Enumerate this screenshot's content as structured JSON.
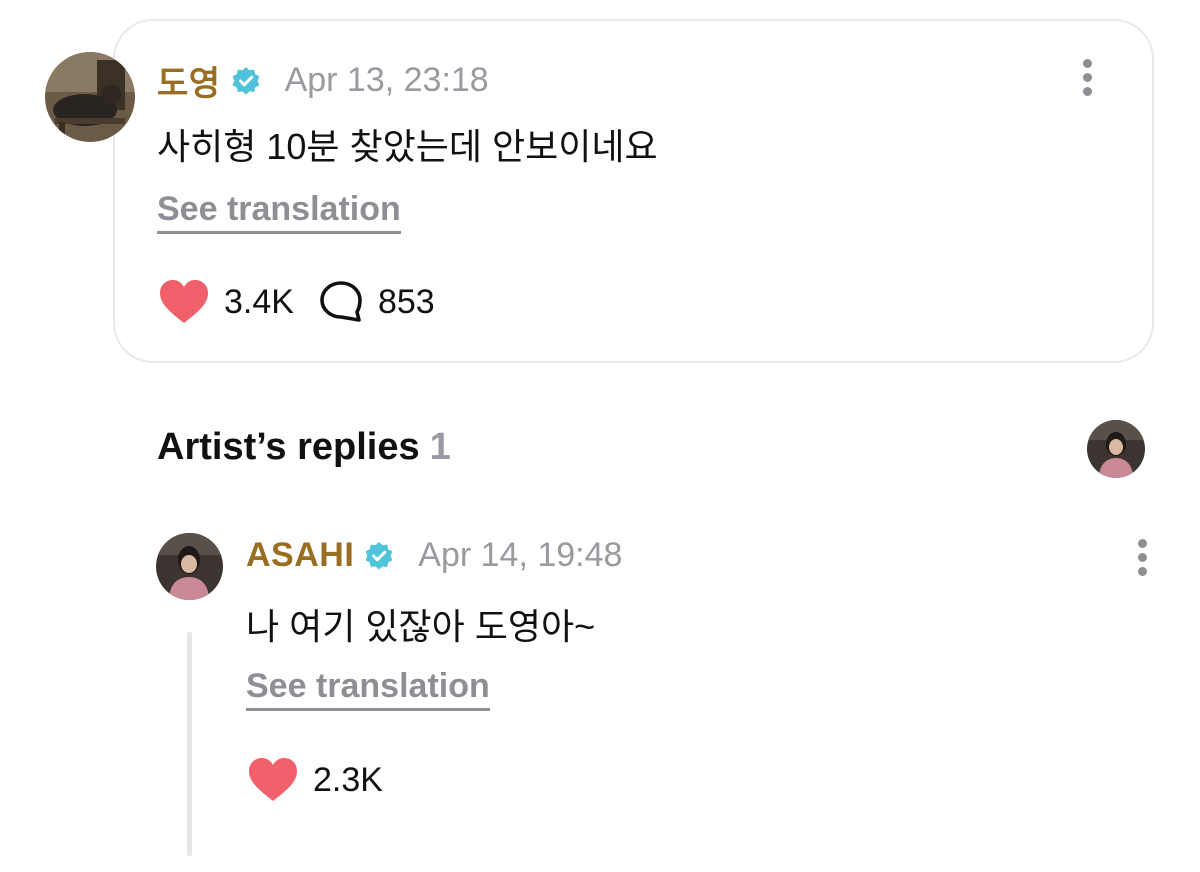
{
  "post": {
    "author": "도영",
    "timestamp": "Apr 13, 23:18",
    "text": "사히형 10분 찾았는데 안보이네요",
    "see_translation": "See translation",
    "likes": "3.4K",
    "comments": "853"
  },
  "artist_replies": {
    "heading": "Artist’s replies",
    "count": "1",
    "reply": {
      "author": "ASAHI",
      "timestamp": "Apr 14, 19:48",
      "text": "나 여기 있잖아 도영아~",
      "see_translation": "See translation",
      "likes": "2.3K"
    }
  },
  "colors": {
    "author_name": "#9a6e22",
    "verified_badge": "#4fc3d9",
    "heart": "#f0606a",
    "muted_text": "#9a9aa0",
    "card_border": "#e9e9ec"
  },
  "icons": {
    "verified": "verified-badge-icon",
    "like": "heart-icon",
    "comment": "comment-bubble-icon",
    "more": "more-vertical-icon"
  }
}
